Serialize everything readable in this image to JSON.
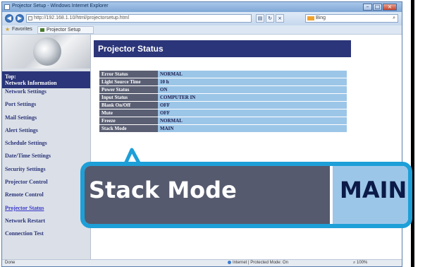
{
  "browser": {
    "title": "Projector Setup - Windows Internet Explorer",
    "url": "http://192.168.1.10/html/projectorsetup.html",
    "search_engine": "Bing",
    "favorites_label": "Favorites",
    "tab_title": "Projector Setup",
    "status_left": "Done",
    "status_zone": "Internet | Protected Mode: On",
    "status_zoom": "100%"
  },
  "sidebar": {
    "top_line1": "Top:",
    "top_line2": "Network Information",
    "items": [
      {
        "label": "Network Settings"
      },
      {
        "label": "Port Settings"
      },
      {
        "label": "Mail Settings"
      },
      {
        "label": "Alert Settings"
      },
      {
        "label": "Schedule Settings"
      },
      {
        "label": "Date/Time Settings"
      },
      {
        "label": "Security Settings"
      },
      {
        "label": "Projector Control"
      },
      {
        "label": "Remote Control"
      },
      {
        "label": "Projector Status",
        "active": true
      },
      {
        "label": "Network Restart"
      },
      {
        "label": "Connection Test"
      }
    ]
  },
  "main": {
    "header": "Projector Status",
    "rows": [
      {
        "label": "Error Status",
        "value": "NORMAL"
      },
      {
        "label": "Light Source Time",
        "value": "10 h"
      },
      {
        "label": "Power Status",
        "value": "ON"
      },
      {
        "label": "Input Status",
        "value": "COMPUTER IN"
      },
      {
        "label": "Blank On/Off",
        "value": "OFF"
      },
      {
        "label": "Mute",
        "value": "OFF"
      },
      {
        "label": "Freeze",
        "value": "NORMAL"
      },
      {
        "label": "Stack Mode",
        "value": "MAIN"
      }
    ]
  },
  "callout": {
    "label": "Stack Mode",
    "value": "MAIN"
  },
  "colors": {
    "nav_blue": "#2b3579",
    "label_bg": "#5a5f73",
    "value_bg": "#9cc6e8",
    "callout_border": "#1d9fd8"
  }
}
